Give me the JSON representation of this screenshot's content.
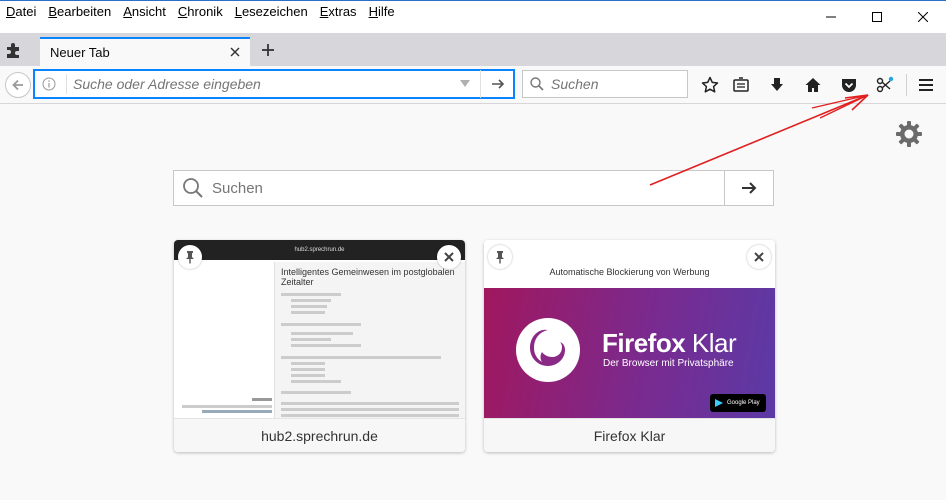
{
  "menu": [
    "Datei",
    "Bearbeiten",
    "Ansicht",
    "Chronik",
    "Lesezeichen",
    "Extras",
    "Hilfe"
  ],
  "menu_underline": [
    "D",
    "B",
    "A",
    "C",
    "L",
    "E",
    "H"
  ],
  "tab": {
    "title": "Neuer Tab"
  },
  "urlbar": {
    "placeholder": "Suche oder Adresse eingeben"
  },
  "searchbar": {
    "placeholder": "Suchen"
  },
  "toolbar_icons": [
    "star-icon",
    "reading-list-icon",
    "download-icon",
    "home-icon",
    "pocket-icon",
    "extension-sparkle-icon",
    "hamburger-menu-icon"
  ],
  "newtab": {
    "search_placeholder": "Suchen",
    "tiles": [
      {
        "label": "hub2.sprechrun.de",
        "thumb_bar": "hub2.sprechrun.de",
        "thumb_title": "Intelligentes Gemeinwesen im postglobalen Zeitalter"
      },
      {
        "label": "Firefox Klar",
        "thumb_heading": "Automatische Blockierung von Werbung",
        "brand_a": "Firefox",
        "brand_b": "Klar",
        "brand_sub": "Der Browser mit Privatsphäre",
        "store_badge": "Google Play"
      }
    ]
  },
  "colors": {
    "accent": "#0a84ff",
    "annotation": "#e02020",
    "tabstrip": "#d7d7db"
  }
}
